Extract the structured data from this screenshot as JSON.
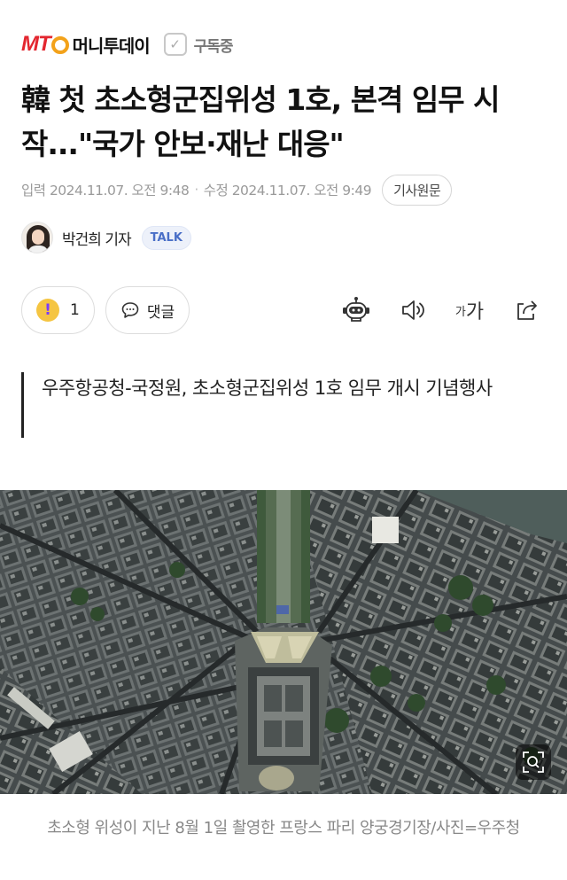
{
  "header": {
    "logo_mark": "MT",
    "logo_name": "머니투데이",
    "subscribe_label": "구독중"
  },
  "article": {
    "title": "韓 첫 초소형군집위성 1호, 본격 임무 시작...\"국가 안보·재난 대응\"",
    "input_time": "입력 2024.11.07. 오전 9:48",
    "modified_time": "수정 2024.11.07. 오전 9:49",
    "separator": "·",
    "original_button": "기사원문",
    "author_name": "박건희 기자",
    "talk_label": "TALK",
    "reaction_count": "1",
    "comment_label": "댓글",
    "font_size_small": "가",
    "font_size_large": "가",
    "subheading": "우주항공청-국정원, 초소형군집위성 1호 임무 개시 기념행사",
    "caption": "초소형 위성이 지난 8월 1일 촬영한 프랑스 파리 양궁경기장/사진=우주청"
  },
  "colors": {
    "brand_red": "#e3262f",
    "brand_orange": "#f3a21a",
    "talk_blue": "#4a6fc7",
    "reaction_yellow": "#f5c542"
  },
  "icons": [
    "check-icon",
    "exclamation-icon",
    "comment-icon",
    "robot-icon",
    "speaker-icon",
    "font-size-icon",
    "share-icon",
    "zoom-icon"
  ]
}
